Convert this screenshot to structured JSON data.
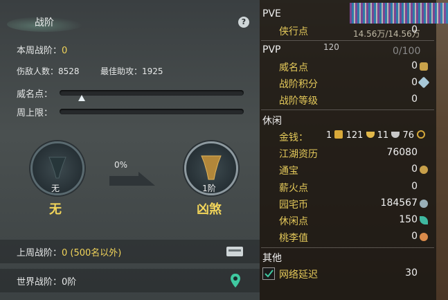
{
  "left": {
    "title": "战阶",
    "help": "?",
    "week_rank_label": "本周战阶：",
    "week_rank_value": "0",
    "kills_label": "伤敌人数：",
    "kills_value": "8528",
    "assist_label": "最佳助攻：",
    "assist_value": "1925",
    "fame_label": "威名点：",
    "fame_progress": 0.12,
    "weekly_cap_label": "周上限：",
    "weekly_cap_progress": 0,
    "progress_percent": "0%",
    "current_medal_label": "无",
    "current_rank_name": "无",
    "next_medal_label": "1阶",
    "next_rank_name": "凶煞",
    "last_week_label": "上周战阶：",
    "last_week_value": "0 (500名以外)",
    "world_label": "世界战阶：",
    "world_value": "0阶"
  },
  "right": {
    "overlay_text": "14.56万/14.56万",
    "overlay_num": "120",
    "overlay_score": "0/100",
    "sections": [
      {
        "name": "PVE",
        "rows": [
          {
            "label": "侠行点",
            "value": "0",
            "icon": "none"
          }
        ]
      },
      {
        "name": "PVP",
        "rows": [
          {
            "label": "威名点",
            "value": "0",
            "icon": "gold-chest-icon"
          },
          {
            "label": "战阶积分",
            "value": "0",
            "icon": "gem-icon"
          },
          {
            "label": "战阶等级",
            "value": "0",
            "icon": "none"
          }
        ]
      },
      {
        "name": "休闲",
        "rows": [
          {
            "label": "金钱：",
            "value": "",
            "icon": "none"
          },
          {
            "label": "江湖资历",
            "value": "76080",
            "icon": "none"
          },
          {
            "label": "通宝",
            "value": "0",
            "icon": "coin-icon"
          },
          {
            "label": "薪火点",
            "value": "0",
            "icon": "none"
          },
          {
            "label": "园宅币",
            "value": "184567",
            "icon": "g-coin-icon"
          },
          {
            "label": "休闲点",
            "value": "150",
            "icon": "leaf-icon"
          },
          {
            "label": "桃李值",
            "value": "0",
            "icon": "peach-icon"
          }
        ]
      },
      {
        "name": "其他",
        "rows": [
          {
            "label": "网络延迟",
            "value": "30",
            "icon": "none"
          }
        ]
      }
    ],
    "money": {
      "a": "1",
      "b": "121",
      "c": "11",
      "d": "76"
    }
  },
  "colors": {
    "label": "#e4c95a",
    "accent": "#f2d55a"
  }
}
